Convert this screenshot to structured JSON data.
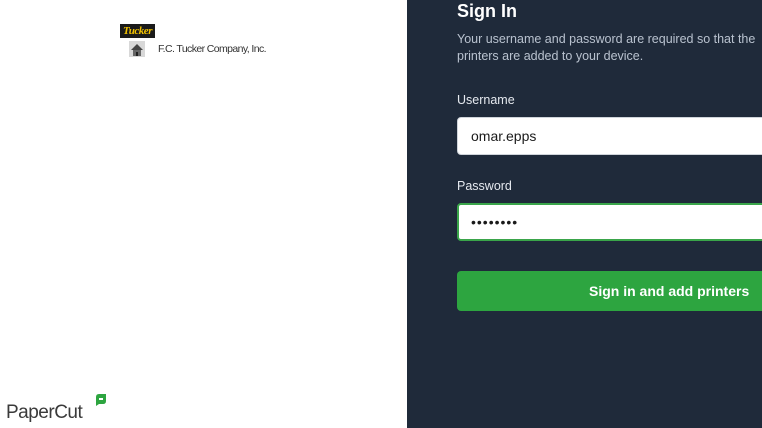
{
  "company": {
    "logo_mark_text": "Tucker",
    "name": "F.C. Tucker Company, Inc."
  },
  "brand": {
    "name": "PaperCut",
    "accent_color": "#2da540"
  },
  "signin": {
    "title": "Sign In",
    "description": "Your username and password are required so that the printers are added to your device.",
    "username_label": "Username",
    "username_value": "omar.epps",
    "password_label": "Password",
    "password_value": "********",
    "button_label": "Sign in and add printers"
  },
  "colors": {
    "panel_background": "#1f2a3a",
    "button": "#2da540",
    "focus_border": "#3aa54a"
  }
}
